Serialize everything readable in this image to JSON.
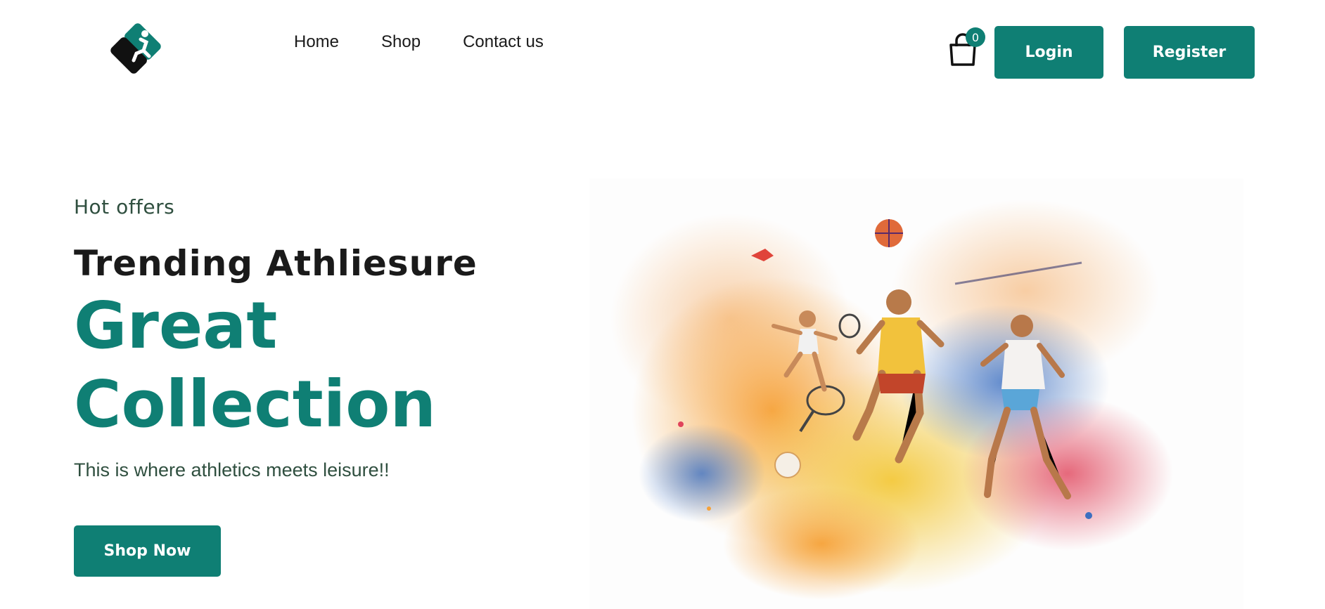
{
  "nav": {
    "items": [
      {
        "label": "Home"
      },
      {
        "label": "Shop"
      },
      {
        "label": "Contact us"
      }
    ]
  },
  "cart": {
    "count": "0",
    "icon": "shopping-bag-icon"
  },
  "auth": {
    "login_label": "Login",
    "register_label": "Register"
  },
  "hero": {
    "eyebrow": "Hot offers",
    "title": "Trending Athliesure",
    "headline": "Great Collection",
    "subtitle": "This is where athletics meets leisure!!",
    "cta_label": "Shop Now"
  },
  "colors": {
    "accent": "#0f7f74",
    "text": "#1a1a1a",
    "muted": "#2f4f3f"
  }
}
